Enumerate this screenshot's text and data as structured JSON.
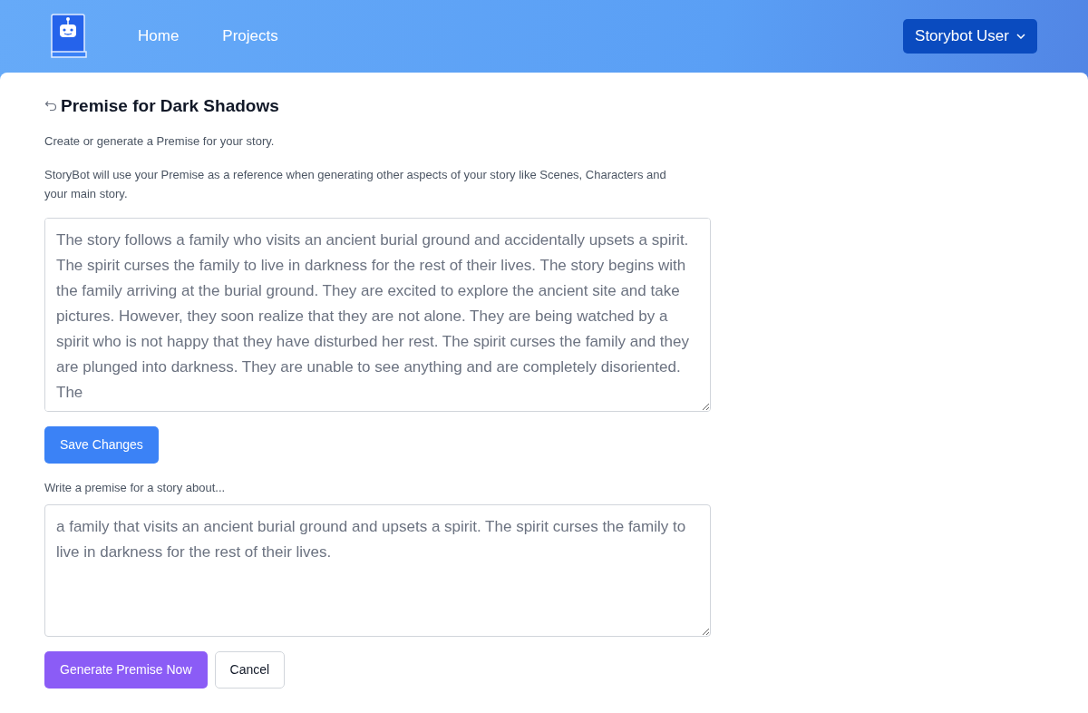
{
  "navbar": {
    "links": [
      "Home",
      "Projects"
    ],
    "user_menu": "Storybot User"
  },
  "page": {
    "title": "Premise for Dark Shadows",
    "intro": "Create or generate a Premise for your story.",
    "description": "StoryBot will use your Premise as a reference when generating other aspects of your story like Scenes, Characters and your main story.",
    "premise": "The story follows a family who visits an ancient burial ground and accidentally upsets a spirit. The spirit curses the family to live in darkness for the rest of their lives. The story begins with the family arriving at the burial ground. They are excited to explore the ancient site and take pictures. However, they soon realize that they are not alone. They are being watched by a spirit who is not happy that they have disturbed her rest. The spirit curses the family and they are plunged into darkness. They are unable to see anything and are completely disoriented. The",
    "save_button": "Save Changes",
    "prompt_label": "Write a premise for a story about...",
    "prompt": "a family that visits an ancient burial ground and upsets a spirit. The spirit curses the family to live in darkness for the rest of their lives.",
    "generate_button": "Generate Premise Now",
    "cancel_button": "Cancel"
  }
}
